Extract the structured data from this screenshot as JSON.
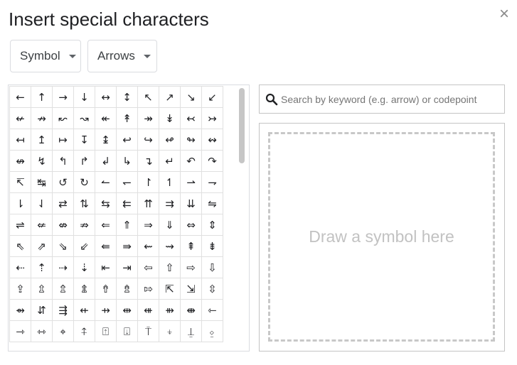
{
  "dialog": {
    "title": "Insert special characters",
    "close_glyph": "×"
  },
  "filters": {
    "category": "Symbol",
    "subcategory": "Arrows"
  },
  "search": {
    "placeholder": "Search by keyword (e.g. arrow) or codepoint",
    "value": ""
  },
  "draw": {
    "placeholder": "Draw a symbol here"
  },
  "grid": {
    "rows": [
      [
        "←",
        "↑",
        "→",
        "↓",
        "↔",
        "↕",
        "↖",
        "↗",
        "↘",
        "↙"
      ],
      [
        "↚",
        "↛",
        "↜",
        "↝",
        "↞",
        "↟",
        "↠",
        "↡",
        "↢",
        "↣"
      ],
      [
        "↤",
        "↥",
        "↦",
        "↧",
        "↨",
        "↩",
        "↪",
        "↫",
        "↬",
        "↭"
      ],
      [
        "↮",
        "↯",
        "↰",
        "↱",
        "↲",
        "↳",
        "↴",
        "↵",
        "↶",
        "↷"
      ],
      [
        "↸",
        "↹",
        "↺",
        "↻",
        "↼",
        "↽",
        "↾",
        "↿",
        "⇀",
        "⇁"
      ],
      [
        "⇂",
        "⇃",
        "⇄",
        "⇅",
        "⇆",
        "⇇",
        "⇈",
        "⇉",
        "⇊",
        "⇋"
      ],
      [
        "⇌",
        "⇍",
        "⇎",
        "⇏",
        "⇐",
        "⇑",
        "⇒",
        "⇓",
        "⇔",
        "⇕"
      ],
      [
        "⇖",
        "⇗",
        "⇘",
        "⇙",
        "⇚",
        "⇛",
        "⇜",
        "⇝",
        "⇞",
        "⇟"
      ],
      [
        "⇠",
        "⇡",
        "⇢",
        "⇣",
        "⇤",
        "⇥",
        "⇦",
        "⇧",
        "⇨",
        "⇩"
      ],
      [
        "⇪",
        "⇫",
        "⇬",
        "⇭",
        "⇮",
        "⇯",
        "⇰",
        "⇱",
        "⇲",
        "⇳"
      ],
      [
        "⇴",
        "⇵",
        "⇶",
        "⇷",
        "⇸",
        "⇹",
        "⇺",
        "⇻",
        "⇼",
        "⇽"
      ],
      [
        "⇾",
        "⇿",
        "⌖",
        "⍏",
        "⍐",
        "⍗",
        "⍑",
        "⍖",
        "⍊",
        "⍚"
      ]
    ]
  },
  "colors": {
    "border": "#dadce0",
    "grid_line": "#e0e0e0",
    "dashed": "#c8c8c8",
    "placeholder_text": "#c2c2c2"
  }
}
